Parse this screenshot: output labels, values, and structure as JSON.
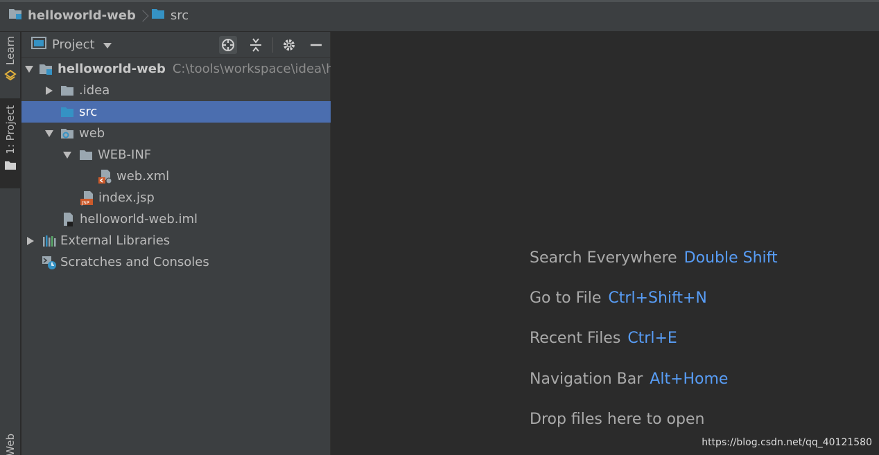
{
  "navbar": {
    "crumbs": [
      {
        "label": "helloworld-web",
        "icon": "module-folder-icon"
      },
      {
        "label": "src",
        "icon": "source-folder-icon"
      }
    ]
  },
  "stripe": {
    "learn": "Learn",
    "project": "1: Project",
    "web": "Web"
  },
  "panel": {
    "title": "Project",
    "buttons": [
      "locate-icon",
      "collapse-all-icon",
      "gear-icon",
      "hide-icon"
    ]
  },
  "tree": [
    {
      "label": "helloworld-web",
      "path": "C:\\tools\\workspace\\idea\\hel",
      "icon": "module-folder-icon",
      "expanded": true,
      "level": 0
    },
    {
      "label": ".idea",
      "icon": "folder-icon",
      "expanded": false,
      "level": 1
    },
    {
      "label": "src",
      "icon": "source-folder-icon",
      "selected": true,
      "level": 1
    },
    {
      "label": "web",
      "icon": "web-folder-icon",
      "expanded": true,
      "level": 1
    },
    {
      "label": "WEB-INF",
      "icon": "folder-icon",
      "expanded": true,
      "level": 2
    },
    {
      "label": "web.xml",
      "icon": "xml-file-icon",
      "level": 3
    },
    {
      "label": "index.jsp",
      "icon": "jsp-file-icon",
      "level": 2
    },
    {
      "label": "helloworld-web.iml",
      "icon": "iml-file-icon",
      "level": 1
    },
    {
      "label": "External Libraries",
      "icon": "libraries-icon",
      "expanded": false,
      "level": 0
    },
    {
      "label": "Scratches and Consoles",
      "icon": "scratches-icon",
      "level": 0
    }
  ],
  "editor": {
    "hints": [
      {
        "text": "Search Everywhere",
        "key": "Double Shift"
      },
      {
        "text": "Go to File",
        "key": "Ctrl+Shift+N"
      },
      {
        "text": "Recent Files",
        "key": "Ctrl+E"
      },
      {
        "text": "Navigation Bar",
        "key": "Alt+Home"
      },
      {
        "text": "Drop files here to open",
        "key": ""
      }
    ],
    "watermark": "https://blog.csdn.net/qq_40121580"
  },
  "colors": {
    "accent_key": "#589df6",
    "selection": "#4b6eaf",
    "folder": "#9aa7b0",
    "source_folder": "#3592c4"
  }
}
